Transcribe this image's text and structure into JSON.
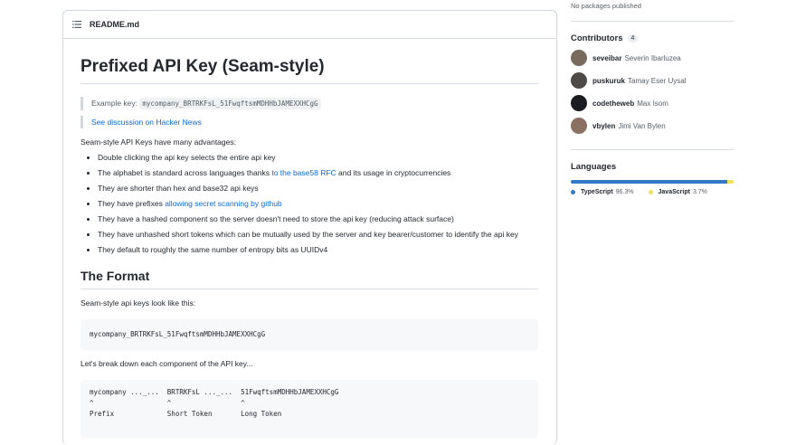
{
  "readme": {
    "filename": "README.md",
    "title": "Prefixed API Key (Seam-style)",
    "example_label": "Example key:",
    "example_key": "mycompany_BRTRKFsL_51FwqftsmMDHHbJAMEXXHCgG",
    "discussion_link": "See discussion on Hacker News",
    "intro": "Seam-style API Keys have many advantages:",
    "advantages": {
      "a1": "Double clicking the api key selects the entire api key",
      "a2_pre": "The alphabet is standard across languages thanks ",
      "a2_link": "to the base58 RFC",
      "a2_post": " and its usage in cryptocurrencies",
      "a3": "They are shorter than hex and base32 api keys",
      "a4_pre": "They have prefixes ",
      "a4_link": "allowing secret scanning by github",
      "a5": "They have a hashed component so the server doesn't need to store the api key (reducing attack surface)",
      "a6": "They have unhashed short tokens which can be mutually used by the server and key bearer/customer to identify the api key",
      "a7": "They default to roughly the same number of entropy bits as UUIDv4"
    },
    "format_heading": "The Format",
    "format_intro": "Seam-style api keys look like this:",
    "format_example": "mycompany_BRTRKFsL_51FwqftsmMDHHbJAMEXXHCgG",
    "breakdown_intro": "Let's break down each component of the API key...",
    "breakdown_code": "mycompany ..._...  BRTRKFsL ..._...  51FwqftsmMDHHbJAMEXXHCgG\n^                  ^                 ^\nPrefix             Short Token       Long Token"
  },
  "sidebar": {
    "packages_text": "No packages published",
    "contributors_title": "Contributors",
    "contributors_count": "4",
    "contributors": [
      {
        "login": "seveibar",
        "name": "Severin Ibarluzea",
        "avatar_color": "#7a6a5e"
      },
      {
        "login": "puskuruk",
        "name": "Tamay Eser Uysal",
        "avatar_color": "#4e4a47"
      },
      {
        "login": "codetheweb",
        "name": "Max Isom",
        "avatar_color": "#1b1d22"
      },
      {
        "login": "vbylen",
        "name": "Jimi Van Bylen",
        "avatar_color": "#8a6f63"
      }
    ],
    "languages_title": "Languages",
    "languages": [
      {
        "name": "TypeScript",
        "percent": "96.3%",
        "value": 96.3,
        "color": "#3178c6"
      },
      {
        "name": "JavaScript",
        "percent": "3.7%",
        "value": 3.7,
        "color": "#f1e05a"
      }
    ]
  }
}
